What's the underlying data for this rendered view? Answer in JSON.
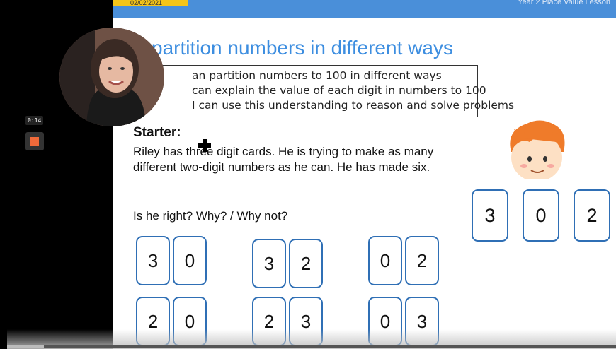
{
  "header": {
    "date": "02/02/2021",
    "lesson_title": "Year 2 Place Value Lesson"
  },
  "slide": {
    "title": "partition numbers in different ways",
    "objectives": [
      "an partition numbers to 100 in different ways",
      "can explain the value of each digit in numbers to 100",
      "I can use this understanding to reason and solve problems"
    ],
    "starter_heading": "Starter:",
    "starter_text": "Riley has three digit cards. He is trying to make as many different two-digit numbers as he can. He has made six.",
    "question": "Is he right?  Why? / Why not?",
    "digit_cards": [
      "3",
      "0",
      "2"
    ],
    "number_pairs": [
      [
        "3",
        "0"
      ],
      [
        "3",
        "2"
      ],
      [
        "0",
        "2"
      ],
      [
        "2",
        "0"
      ],
      [
        "2",
        "3"
      ],
      [
        "0",
        "3"
      ]
    ]
  },
  "recording": {
    "timer": "0:14",
    "progress_fraction": 0.06
  }
}
